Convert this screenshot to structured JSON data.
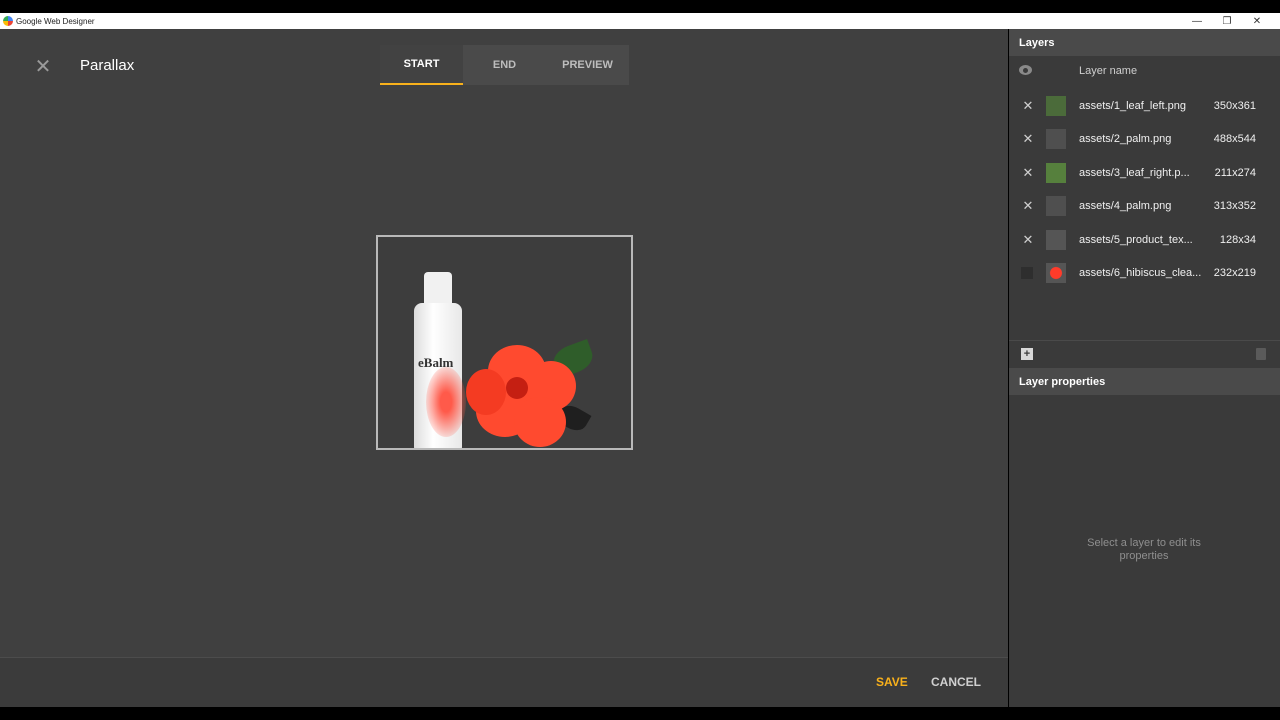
{
  "window": {
    "title": "Google Web Designer",
    "minimize_glyph": "—",
    "restore_glyph": "❐",
    "close_glyph": "✕"
  },
  "dialog": {
    "title": "Parallax",
    "close_icon": "close-icon",
    "tabs": [
      {
        "label": "START",
        "active": true
      },
      {
        "label": "END",
        "active": false
      },
      {
        "label": "PREVIEW",
        "active": false
      }
    ],
    "save_label": "SAVE",
    "cancel_label": "CANCEL",
    "accent_color": "#f9b11b"
  },
  "stage": {
    "product_brand": "eBalm"
  },
  "layers_panel": {
    "title": "Layers",
    "column_header": "Layer name",
    "layers": [
      {
        "name": "assets/1_leaf_left.png",
        "size": "350x361",
        "thumb": "leaf"
      },
      {
        "name": "assets/2_palm.png",
        "size": "488x544",
        "thumb": "palm"
      },
      {
        "name": "assets/3_leaf_right.p...",
        "size": "211x274",
        "thumb": "leaf"
      },
      {
        "name": "assets/4_palm.png",
        "size": "313x352",
        "thumb": "palm"
      },
      {
        "name": "assets/5_product_tex...",
        "size": "128x34",
        "thumb": "text"
      },
      {
        "name": "assets/6_hibiscus_clea...",
        "size": "232x219",
        "thumb": "hibiscus"
      }
    ]
  },
  "properties_panel": {
    "title": "Layer properties",
    "hint": "Select a layer to edit its properties"
  }
}
